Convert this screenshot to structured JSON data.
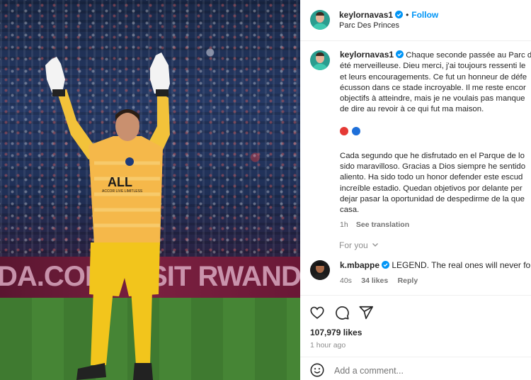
{
  "post": {
    "image_alt": "Goalkeeper in a yellow PSG jersey pointing both hands upward in front of a stadium crowd",
    "banner_left": "DA.COM",
    "banner_right": "ISIT RWANDA",
    "jersey_sponsor": "ALL",
    "jersey_sub": "ACCOR LIVE LIMITLESS"
  },
  "header": {
    "username": "keylornavas1",
    "follow_label": "Follow",
    "location": "Parc Des Princes"
  },
  "caption": {
    "username": "keylornavas1",
    "fr_lines": [
      "Chaque seconde passée au Parc des",
      "été merveilleuse. Dieu merci, j'ai toujours ressenti le",
      "et leurs encouragements. Ce fut un honneur de défe",
      "écusson dans ce stade incroyable. Il me reste encor",
      "objectifs à atteindre, mais je ne voulais pas manque",
      "de dire au revoir à ce qui fut ma maison."
    ],
    "es_lines": [
      "Cada segundo que he disfrutado en el Parque de lo",
      "sido maravilloso. Gracias a Dios siempre he sentido",
      "aliento. Ha sido todo un honor defender este escud",
      "increíble estadio. Quedan objetivos por delante per",
      "dejar pasar la oportunidad de despedirme de la que",
      "casa."
    ],
    "time": "1h",
    "see_translation": "See translation",
    "emoji_colors": [
      "#e53935",
      "#1e6fd9"
    ]
  },
  "for_you": {
    "label": "For you"
  },
  "comment": {
    "username": "k.mbappe",
    "text": "LEGEND. The real ones will never forg",
    "time": "40s",
    "likes": "34 likes",
    "reply": "Reply"
  },
  "actions": {
    "likes_count": "107,979 likes",
    "time_ago": "1 hour ago",
    "add_comment_placeholder": "Add a comment..."
  },
  "colors": {
    "accent": "#0095f6",
    "verified": "#0095f6",
    "muted": "#737373"
  },
  "icons": {
    "like": "heart-icon",
    "comment": "comment-bubble-icon",
    "share": "paper-plane-icon",
    "emoji": "smiley-icon",
    "verified": "verified-badge-icon",
    "for_you_chevron": "chevron-down-icon"
  }
}
